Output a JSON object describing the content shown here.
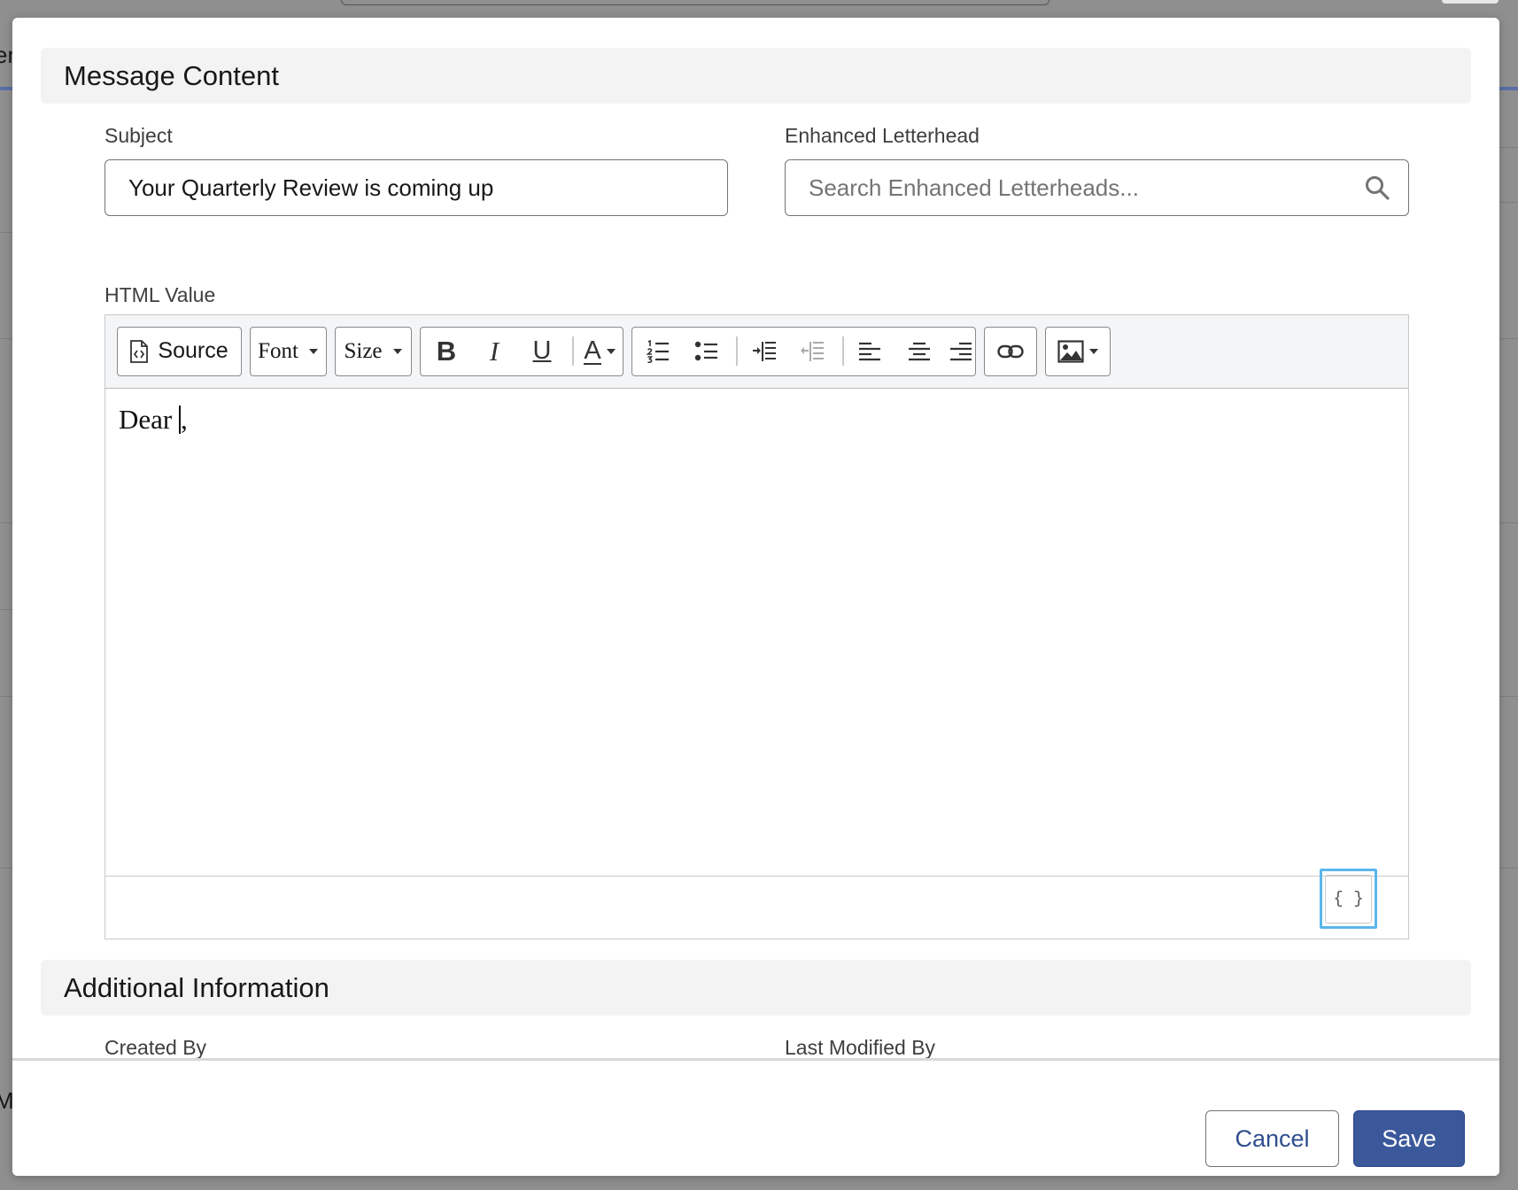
{
  "background": {
    "left_texts": [
      "en",
      "M"
    ]
  },
  "message_content": {
    "title": "Message Content",
    "subject": {
      "label": "Subject",
      "value": "Your Quarterly Review is coming up"
    },
    "letterhead": {
      "label": "Enhanced Letterhead",
      "placeholder": "Search Enhanced Letterheads...",
      "icon": "search-icon"
    },
    "html_value": {
      "label": "HTML Value",
      "toolbar": {
        "source_label": "Source",
        "font_label": "Font",
        "size_label": "Size",
        "bold_glyph": "B",
        "italic_glyph": "I",
        "underline_glyph": "U",
        "text_color_glyph": "A"
      },
      "body_text_before": "Dear ",
      "body_text_after": ",",
      "merge_field_glyph": "{ }"
    }
  },
  "additional_information": {
    "title": "Additional Information",
    "created_by_label": "Created By",
    "last_modified_by_label": "Last Modified By"
  },
  "footer": {
    "cancel_label": "Cancel",
    "save_label": "Save"
  },
  "colors": {
    "accent": "#3b589b",
    "focus_ring": "#5bb6ec",
    "overlay": "#8f8f8f"
  }
}
